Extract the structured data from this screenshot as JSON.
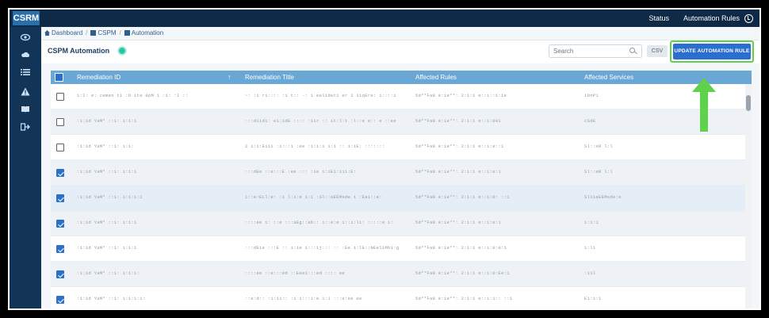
{
  "app": {
    "logo": "CSRM"
  },
  "topnav": {
    "status_label": "Status",
    "automation_rules_label": "Automation Rules"
  },
  "sidebar": {
    "icons": [
      "eye-icon",
      "cloud-icon",
      "list-icon",
      "warning-icon",
      "book-icon",
      "logout-icon"
    ]
  },
  "breadcrumb": {
    "items": [
      "Dashboard",
      "CSPM",
      "Automation"
    ]
  },
  "header": {
    "title": "CSPM Automation",
    "search_placeholder": "Search",
    "csv_label": "CSV",
    "update_button": "UPDATE AUTOMATION RULE"
  },
  "colors": {
    "accent": "#2a6fce",
    "highlight": "#5fd24b",
    "header": "#6aa7d4",
    "nav": "#0e2a47"
  },
  "table": {
    "columns": [
      "Remediation ID",
      "Remediation Title",
      "Affected Rules",
      "Affected Services"
    ],
    "rows": [
      {
        "checked": false,
        "id": "1:I: e:  cemen t1 :D  ite 0pM 1 :1: :I ::",
        "title": "~: :i ri:::: :i   t:: -:  i eelideti er 1 iiqEre:  i::::i",
        "rules": "5d**Fa8 e:1e**: 2:1:1 e::1::1:ie",
        "services": "iDnP1"
      },
      {
        "checked": false,
        "id": ":1:1d  YaM*  ::1: i:1:1",
        "title": ":::diidi:  e1:1dE  ::::  :iir    :: it:l:t  :l::e  e:: e ::ee",
        "rules": "5d**Fa8 e:1e**: 2:1:1 e::1:001",
        "services": "cSdE"
      },
      {
        "checked": false,
        "id": ":1:1d  YaM*  ::1: i:1:",
        "title": "2  i:i:Eiii  :i:::1  :ee   :i:i:i i:i  :: i:iE: :::::::",
        "rules": "5d**Fa8 e:1e**: 2:1:1 e::1:e::1",
        "services": "Sl::eR  l:l"
      },
      {
        "checked": true,
        "id": ":1:1d  YaM*  ::1: i:1:1",
        "title": ":::dEe   ::e:::E  :ee  :::  :ie  i:iEi:iii:E:",
        "rules": "5d**Fa8 e:1e**: 2:1:1 e::1:e:1",
        "services": "Sl::eR  l:l"
      },
      {
        "checked": true,
        "id": ":1:1d  YaM*  ::1: i:1:1:i",
        "title": "i::e:ELl:e:  :i  l:i:e  1:1  :Sl::aEEMsde  i  :Eai::e:",
        "rules": "5d**Fa8 e:1e**: 2:1:1 e::1:0: ::1",
        "services": "SliiaEEMsde:e"
      },
      {
        "checked": true,
        "id": ":1:1d  YaM*  ::1: i:1:1",
        "title": "::::ee  i: ::e  :::aEg::ab::  i::e:e  i::i:li:  :::::e  i:",
        "rules": "5d**Fa8 e:1e**: 2:1:1 e::1:e:1",
        "services": "1:1:1"
      },
      {
        "checked": true,
        "id": ":1:1d  YaM*  ::1: i:1:1",
        "title": ":::dEie  :::E  ::  i:ie  i:::ij:::  ::  :Ee  i:lE::NEeliMbi:g",
        "rules": "5d**Fa8 e:1e**: 2:1:1 e::1:0:0:1",
        "services": "1:l1"
      },
      {
        "checked": true,
        "id": ":1:1d  YaM*  ::1: i:1:1:",
        "title": "::::ee  ::e:::ed  ::Eeei:::ed  :::: ee",
        "rules": "5d**Fa8 e:1e**: 2:1:1 e::1:0:Ee:1",
        "services": ":i1l"
      },
      {
        "checked": true,
        "id": ":1:1d  YaM*  ::1: i:1:1:i:",
        "title": "::e:d::  :i:ii::   :i  i:::i:e   1:1   :::e:ee  ee",
        "rules": "5d**Fa8 e:1e**: 2:1:1 e::1:1:: ::1",
        "services": "Ei:1:1"
      }
    ]
  }
}
